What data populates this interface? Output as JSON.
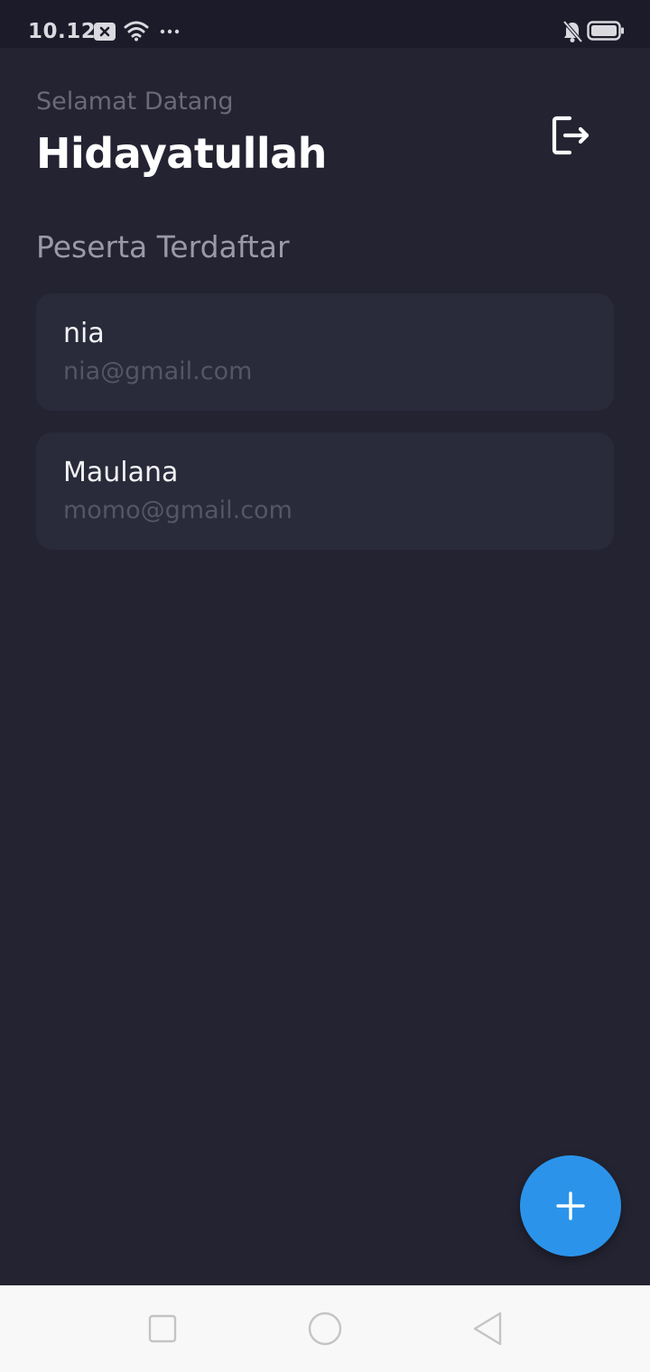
{
  "status_bar": {
    "time": "10.12",
    "icons": [
      "notification-close-icon",
      "wifi-icon",
      "more-dots-icon",
      "mute-bell-icon",
      "battery-icon"
    ]
  },
  "header": {
    "greeting": "Selamat Datang",
    "user_name": "Hidayatullah",
    "logout_icon": "logout-icon"
  },
  "section": {
    "title": "Peserta Terdaftar"
  },
  "participants": [
    {
      "name": "nia",
      "email": "nia@gmail.com"
    },
    {
      "name": "Maulana",
      "email": "momo@gmail.com"
    }
  ],
  "fab": {
    "icon": "plus-icon",
    "color": "#2b94ea"
  },
  "nav_bar": {
    "buttons": [
      "recent-apps-icon",
      "home-icon",
      "back-icon"
    ]
  },
  "colors": {
    "background": "#242332",
    "card": "#292a3a",
    "accent": "#2b94ea"
  }
}
